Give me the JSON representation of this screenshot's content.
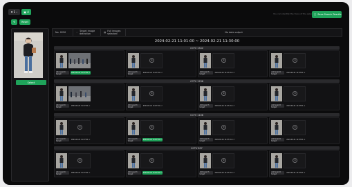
{
  "toolbar": {
    "buttons": [
      "⌗ 1 ‹",
      "▣ 4"
    ],
    "hint": "You can identify the trace of the selected target",
    "save_label": "Save Search Results"
  },
  "subtoolbar": {
    "buttons": [
      "⟲",
      "Reset"
    ]
  },
  "left": {
    "select_label": "Select"
  },
  "filter": {
    "count": "No. 0250",
    "items": [
      "Target image detection",
      "Full images selected"
    ],
    "right": "No data output"
  },
  "range": "2024-02-21 11:01:00 ~ 2024-02-21 11:30:00",
  "sections": [
    {
      "title": "CCTV 1542"
    },
    {
      "title": "CCTV 1238"
    },
    {
      "title": "CCTV 1108"
    },
    {
      "title": "CCTV 837"
    }
  ],
  "card": {
    "tag_label": "Add search target",
    "stamp": "2024-02-21 11:07:01  ⊙ 82%"
  },
  "colors": {
    "accent": "#1fa35a",
    "bg": "#0b0b0c",
    "panel": "#141416"
  }
}
